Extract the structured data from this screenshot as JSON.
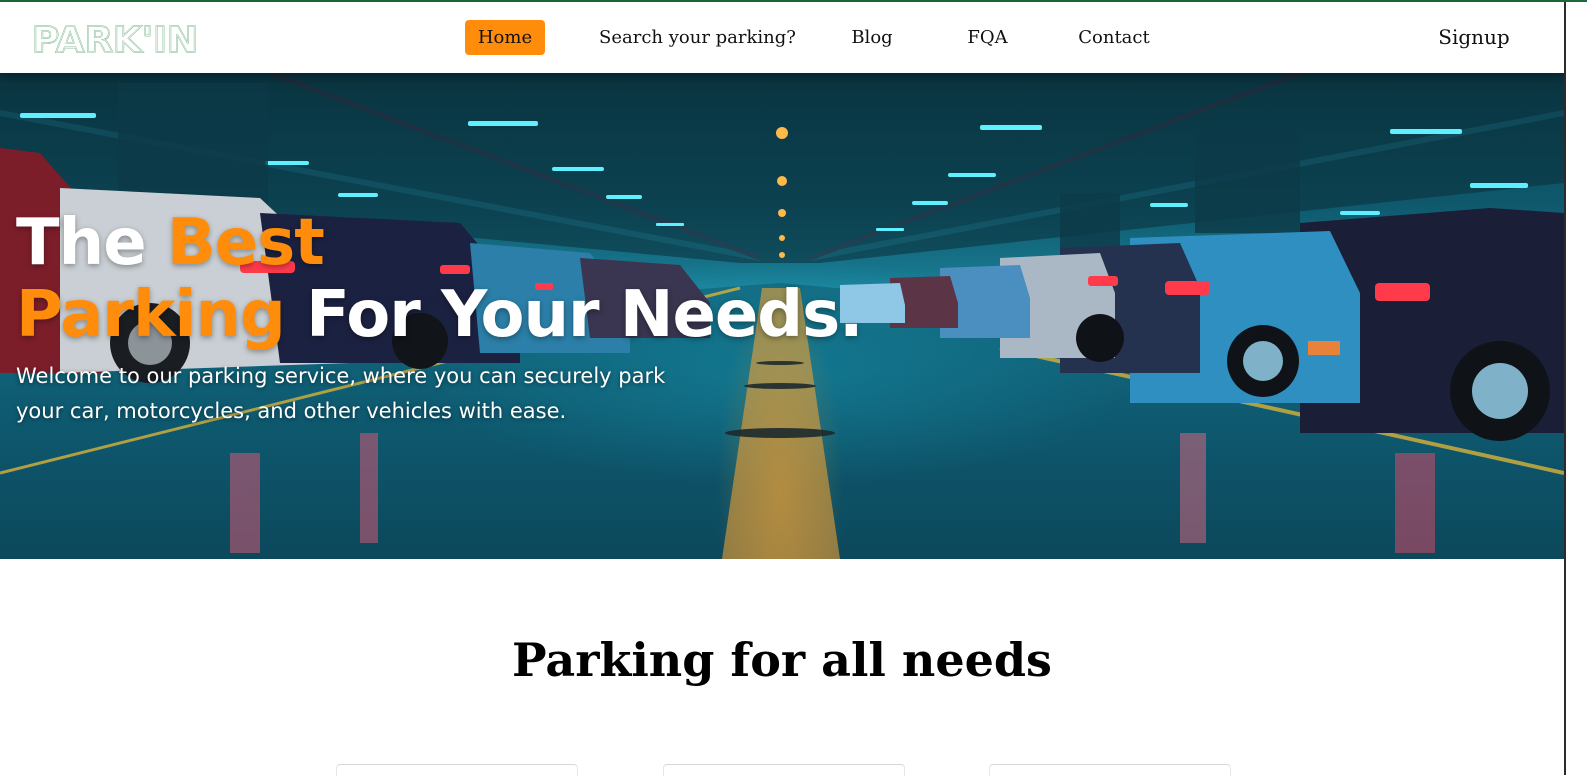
{
  "brand": {
    "logo_text": "PARK'IN",
    "logo_color": "#2e8b4a",
    "accent_color": "#ff8c0a",
    "top_line_color": "#1d6b3a"
  },
  "nav": {
    "home": "Home",
    "search": "Search your parking?",
    "blog": "Blog",
    "fqa": "FQA",
    "contact": "Contact",
    "signup": "Signup",
    "active": "Home"
  },
  "hero": {
    "title_part1": "The ",
    "title_accent1": "Best",
    "title_accent2": "Parking",
    "title_part2": " For Your Needs.",
    "description": "Welcome to our parking service, where you can securely park your car, motorcycles, and other vehicles with ease.",
    "background_description_icon": "parking-garage-photo"
  },
  "section": {
    "title": "Parking for all needs"
  }
}
